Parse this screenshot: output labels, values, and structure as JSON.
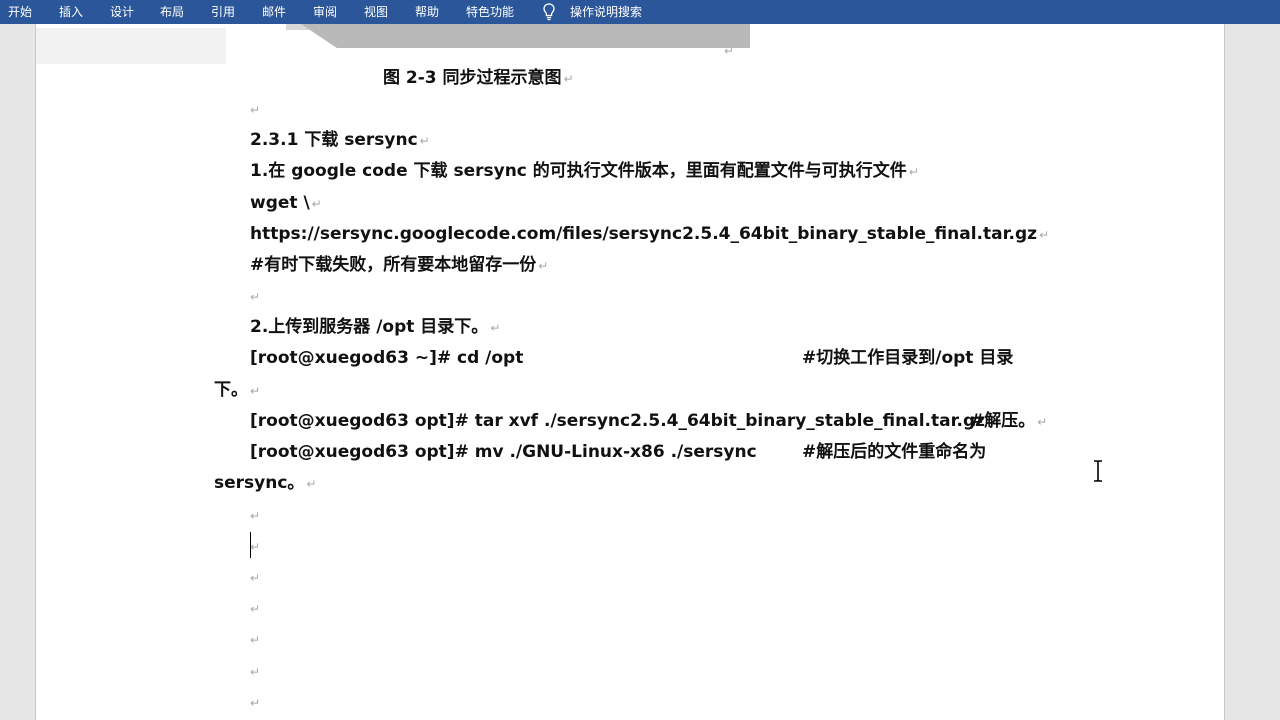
{
  "ribbon": {
    "tabs": [
      "开始",
      "插入",
      "设计",
      "布局",
      "引用",
      "邮件",
      "审阅",
      "视图",
      "帮助",
      "特色功能"
    ],
    "tell_me": "操作说明搜索"
  },
  "doc": {
    "figure_caption": "图 2-3  同步过程示意图",
    "heading": "2.3.1   下载 sersync",
    "step1": "1.在 google code 下载 sersync 的可执行文件版本，里面有配置文件与可执行文件",
    "wget": "wget \\",
    "url": "https://sersync.googlecode.com/files/sersync2.5.4_64bit_binary_stable_final.tar.gz",
    "note": "#有时下载失败，所有要本地留存一份",
    "step2": "2.上传到服务器  /opt 目录下。",
    "cmd_cd": "[root@xuegod63 ~]# cd /opt",
    "cmd_cd_comment": "#切换工作目录到/opt 目录",
    "cmd_cd_wrap": "下。",
    "cmd_tar": "[root@xuegod63 opt]# tar xvf ./sersync2.5.4_64bit_binary_stable_final.tar.gz",
    "cmd_tar_comment": "#解压。",
    "cmd_mv": "[root@xuegod63 opt]# mv ./GNU-Linux-x86   ./sersync",
    "cmd_mv_comment": "#解压后的文件重命名为",
    "cmd_mv_wrap": "sersync。",
    "para_mark": "↵"
  },
  "colors": {
    "ribbon": "#2b579a",
    "page": "#ffffff",
    "canvas": "#e6e6e6",
    "para_mark": "#a8a8a8"
  },
  "icons": [
    "lightbulb-icon",
    "ibeam-cursor-icon"
  ]
}
